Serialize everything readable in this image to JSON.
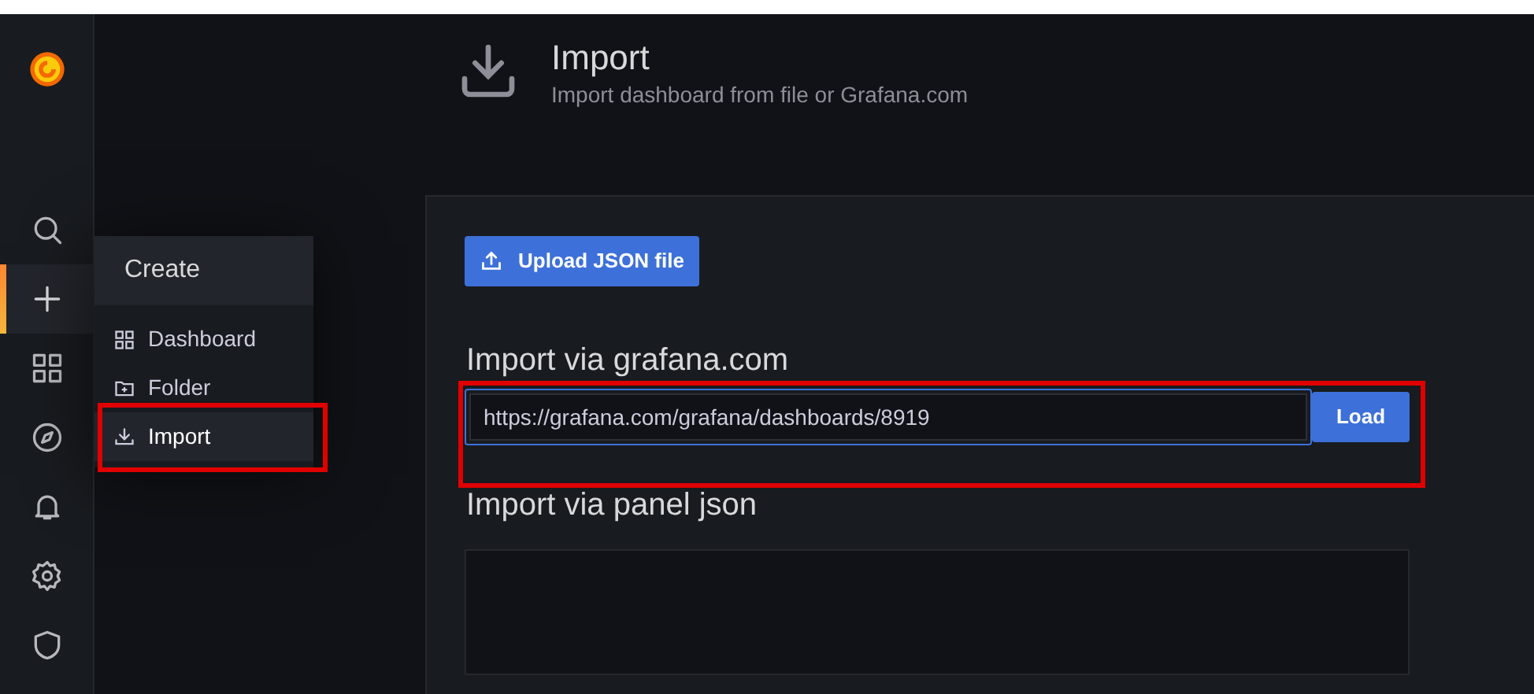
{
  "sidebar": {
    "items": [
      {
        "kind": "search",
        "selected": false
      },
      {
        "kind": "create",
        "selected": true
      },
      {
        "kind": "dashboards",
        "selected": false
      },
      {
        "kind": "explore",
        "selected": false
      },
      {
        "kind": "alerting",
        "selected": false
      },
      {
        "kind": "settings",
        "selected": false
      },
      {
        "kind": "shield",
        "selected": false
      }
    ]
  },
  "create_menu": {
    "title": "Create",
    "items": [
      {
        "kind": "dashboard",
        "label": "Dashboard",
        "selected": false,
        "highlighted": false
      },
      {
        "kind": "folder",
        "label": "Folder",
        "selected": false,
        "highlighted": false
      },
      {
        "kind": "import",
        "label": "Import",
        "selected": true,
        "highlighted": true
      }
    ]
  },
  "header": {
    "title": "Import",
    "subtitle": "Import dashboard from file or Grafana.com"
  },
  "upload_button": "Upload JSON file",
  "grafana_import": {
    "heading": "Import via grafana.com",
    "value": "https://grafana.com/grafana/dashboards/8919",
    "button": "Load",
    "highlighted": true
  },
  "panel_json": {
    "heading": "Import via panel json"
  }
}
